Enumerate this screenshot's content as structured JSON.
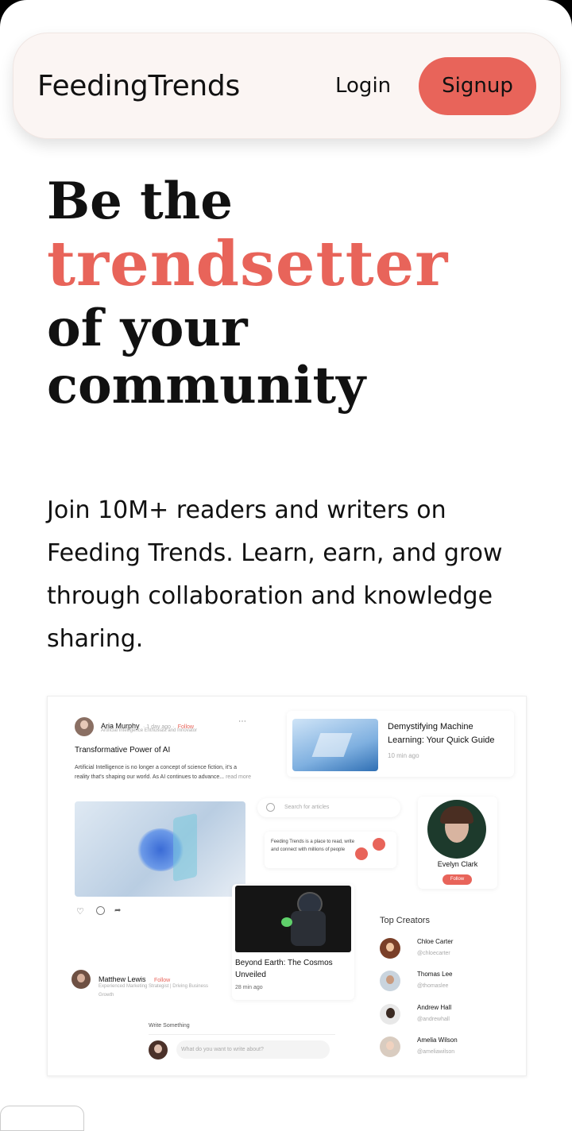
{
  "nav": {
    "brand": "FeedingTrends",
    "login": "Login",
    "signup": "Signup"
  },
  "hero": {
    "line1": "Be the",
    "line2": "trendsetter",
    "line3": "of your",
    "line4": "community",
    "description": "Join 10M+ readers and writers on Feeding Trends. Learn, earn, and grow through collaboration and knowledge sharing."
  },
  "preview": {
    "post1": {
      "author": "Aria Murphy",
      "meta": "· 1 day ago ·",
      "follow": "Follow",
      "role": "Artificial Intelligence Enthusiast and Innovator",
      "title": "Transformative Power of AI",
      "body": "Artificial Intelligence is no longer a concept of science fiction, it's a reality that's shaping our world. As AI continues to advance...",
      "readmore": "read more"
    },
    "article1": {
      "title": "Demystifying Machine Learning: Your Quick Guide",
      "time": "10 min ago"
    },
    "search_placeholder": "Search for articles",
    "about": "Feeding Trends is a place to read, write and connect with millions of people",
    "creator_card": {
      "name": "Evelyn Clark",
      "follow": "Follow"
    },
    "article2": {
      "title": "Beyond Earth: The Cosmos Unveiled",
      "time": "28 min ago"
    },
    "post2": {
      "author": "Matthew Lewis",
      "follow": "Follow",
      "role": "Experienced Marketing Strategist | Driving Business Growth"
    },
    "composer": {
      "label": "Write Something",
      "placeholder": "What do you want to write about?"
    },
    "top_creators": {
      "title": "Top Creators",
      "items": [
        {
          "name": "Chloe Carter",
          "handle": "@chloecarter"
        },
        {
          "name": "Thomas Lee",
          "handle": "@thomaslee"
        },
        {
          "name": "Andrew Hall",
          "handle": "@andrewhall"
        },
        {
          "name": "Amelia Wilson",
          "handle": "@ameliawilson"
        }
      ]
    }
  }
}
